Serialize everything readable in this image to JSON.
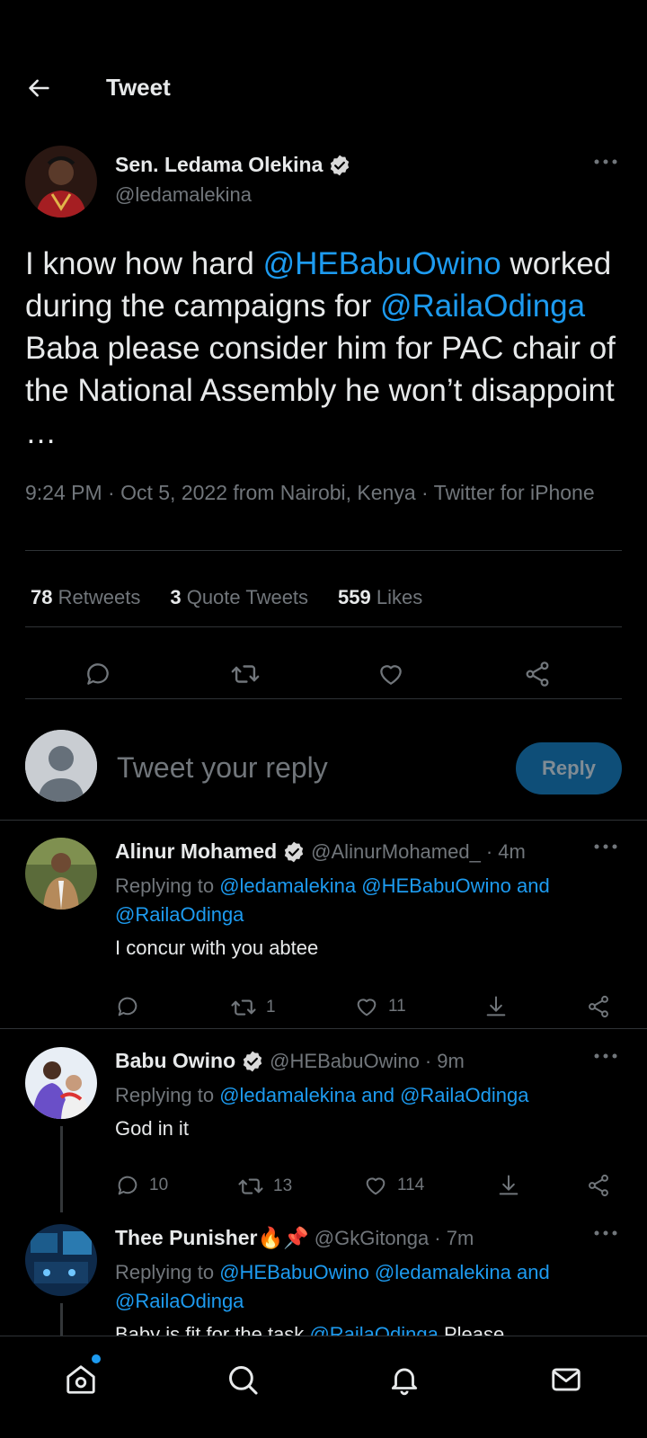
{
  "header": {
    "title": "Tweet"
  },
  "tweet": {
    "author_name": "Sen. Ledama Olekina",
    "author_handle": "@ledamalekina",
    "text_parts": [
      {
        "t": "I know how hard ",
        "link": false
      },
      {
        "t": "@HEBabuOwino",
        "link": true
      },
      {
        "t": " worked during the campaigns for ",
        "link": false
      },
      {
        "t": "@RailaOdinga",
        "link": true
      },
      {
        "t": " Baba please consider him for PAC chair of the National Assembly he won’t disappoint …",
        "link": false
      }
    ],
    "meta": "9:24 PM · Oct 5, 2022 from Nairobi, Kenya · Twitter for iPhone",
    "retweets_count": "78",
    "retweets_label": "Retweets",
    "quotes_count": "3",
    "quotes_label": "Quote Tweets",
    "likes_count": "559",
    "likes_label": "Likes"
  },
  "reply_box": {
    "placeholder": "Tweet your reply",
    "button": "Reply"
  },
  "replies": [
    {
      "name": "Alinur Mohamed",
      "handle": "@AlinurMohamed_",
      "time": "· 4m",
      "replying_label": "Replying to ",
      "replying_to": "@ledamalekina @HEBabuOwino and @RailaOdinga",
      "text": "I concur with you abtee",
      "comments": "",
      "retweets": "1",
      "likes": "11"
    },
    {
      "name": "Babu Owino",
      "handle": "@HEBabuOwino",
      "time": "· 9m",
      "replying_label": "Replying to ",
      "replying_to": "@ledamalekina and @RailaOdinga",
      "text": "God in it",
      "comments": "10",
      "retweets": "13",
      "likes": "114"
    },
    {
      "name": "Thee Punisher🔥📌",
      "handle": "@GkGitonga",
      "time": "· 7m",
      "replying_label": "Replying to ",
      "replying_to": "@HEBabuOwino @ledamalekina and @RailaOdinga",
      "text_plain": "Baby is fit for the task ",
      "text_link": "@RailaOdinga",
      "text_tail": " Please"
    }
  ],
  "icons": {
    "back": "arrow-left-icon",
    "more": "more-horizontal-icon",
    "verified": "verified-badge-icon",
    "comment": "comment-icon",
    "retweet": "retweet-icon",
    "like": "heart-icon",
    "share": "share-icon",
    "download": "download-icon",
    "home": "home-icon",
    "search": "search-icon",
    "notifications": "bell-icon",
    "messages": "mail-icon"
  },
  "colors": {
    "accent": "#1d9bf0",
    "background": "#000000",
    "text": "#e7e9ea",
    "muted": "#71767b",
    "divider": "#2f3336"
  }
}
